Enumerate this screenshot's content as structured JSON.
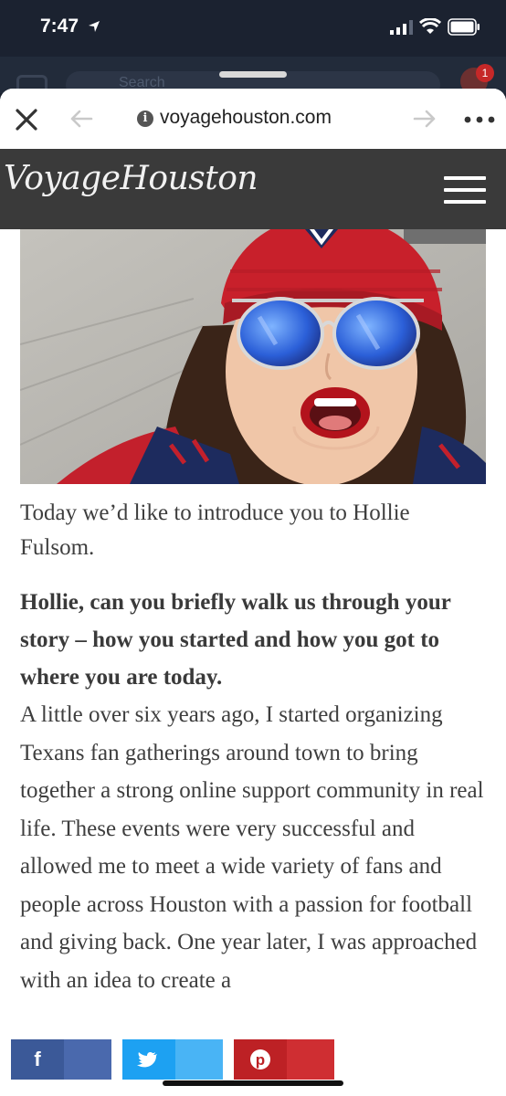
{
  "status_bar": {
    "time": "7:47"
  },
  "background_app": {
    "search_placeholder": "Search",
    "badge_count": "1"
  },
  "browser": {
    "url": "voyagehouston.com",
    "icons": [
      "close-icon",
      "back-arrow-icon",
      "info-icon",
      "forward-arrow-icon",
      "more-icon"
    ]
  },
  "site": {
    "logo": "VoyageHouston",
    "menu_icon": "hamburger-menu-icon"
  },
  "article": {
    "intro": "Today we’d like to introduce you to Hollie Fulsom.",
    "question": "Hollie, can you briefly walk us through your story – how you started and how you got to where you are today.",
    "answer": "A little over six years ago, I started organizing Texans fan gatherings around town to bring together a strong online support community in real life. These events were very successful and allowed me to meet a wide variety of fans and people across Houston with a passion for football and giving back. One year later, I was approached with an idea to create a"
  },
  "share": {
    "facebook_icon": "f",
    "pinterest_icon": "p",
    "colors": {
      "facebook_dark": "#3b5998",
      "facebook_light": "#4a69ad",
      "twitter_dark": "#1da1f2",
      "twitter_light": "#49b4f5",
      "pinterest_dark": "#bd2125",
      "pinterest_light": "#cf2e32"
    }
  }
}
